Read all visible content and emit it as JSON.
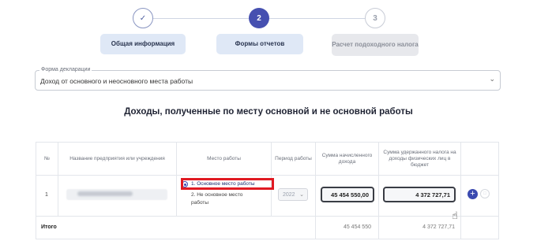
{
  "stepper": {
    "steps": [
      {
        "number": "✓",
        "label": "Общая информация",
        "state": "done"
      },
      {
        "number": "2",
        "label": "Формы отчетов",
        "state": "active"
      },
      {
        "number": "3",
        "label": "Расчет подоходного налога",
        "state": "todo"
      }
    ]
  },
  "declaration": {
    "label": "Форма декларации",
    "value": "Доход от основного и неосновного места работы",
    "chevron": "⌄"
  },
  "section_title": "Доходы, полученные по месту основной и не основной работы",
  "table": {
    "headers": [
      "№",
      "Название предприятия или учреждения",
      "Место работы",
      "Период работы",
      "Сумма начисленного дохода",
      "Сумма удержанного налога на доходы физических лиц в бюджет",
      ""
    ],
    "rows": [
      {
        "number": "1",
        "workplace_options": [
          "1. Основное место работы",
          "2. Не основное место работы"
        ],
        "selected_option": 0,
        "period": "2022",
        "income": "45 454 550,00",
        "tax": "4 372 727,71",
        "add_label": "+",
        "delete_label": "□"
      }
    ],
    "total": {
      "label": "Итого",
      "income": "45 454 550",
      "tax": "4 372 727,71"
    }
  },
  "colors": {
    "accent": "#3b4ab0",
    "highlight": "#e01a22",
    "step_button_bg": "#dfe8f6"
  }
}
